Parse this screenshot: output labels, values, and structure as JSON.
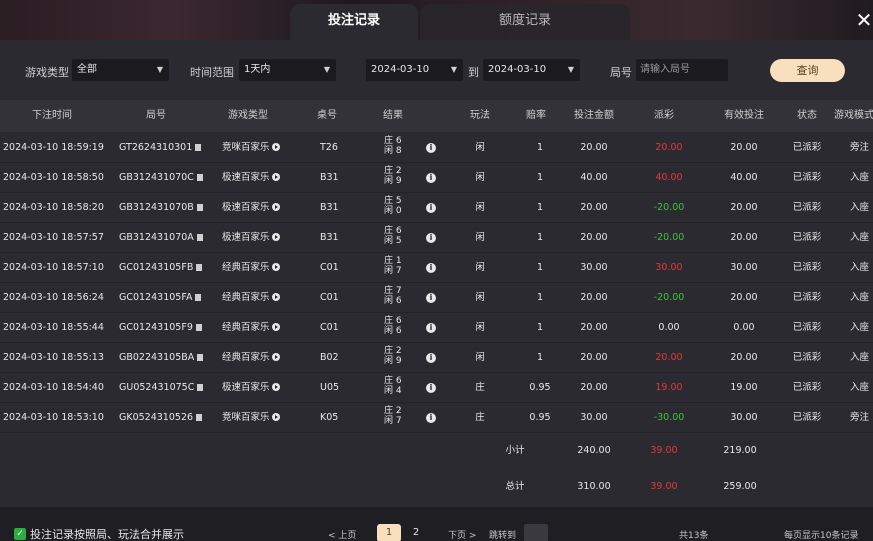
{
  "tabs": [
    {
      "label": "投注记录",
      "active": true
    },
    {
      "label": "额度记录",
      "active": false
    }
  ],
  "close_icon": "close-icon",
  "filters": {
    "game_type_label": "游戏类型",
    "game_type_value": "全部",
    "time_range_label": "时间范围",
    "time_range_value": "1天内",
    "date_from": "2024-03-10",
    "to_label": "到",
    "date_to": "2024-03-10",
    "round_label": "局号",
    "round_placeholder": "请输入局号",
    "query_label": "查询"
  },
  "columns": [
    "下注时间",
    "局号",
    "游戏类型",
    "桌号",
    "结果",
    "玩法",
    "赔率",
    "投注金额",
    "派彩",
    "有效投注",
    "状态",
    "游戏模式"
  ],
  "rows": [
    {
      "time": "2024-03-10 18:59:19",
      "round": "GT2624310301",
      "game": "竞咪百家乐",
      "table": "T26",
      "r1": "庄 6",
      "r2": "闲 8",
      "play": "闲",
      "odds": "1",
      "amount": "20.00",
      "payout": "20.00",
      "payout_sign": "pos",
      "valid": "20.00",
      "status": "已派彩",
      "mode": "旁注"
    },
    {
      "time": "2024-03-10 18:58:50",
      "round": "GB312431070C",
      "game": "极速百家乐",
      "table": "B31",
      "r1": "庄 2",
      "r2": "闲 9",
      "play": "闲",
      "odds": "1",
      "amount": "40.00",
      "payout": "40.00",
      "payout_sign": "pos",
      "valid": "40.00",
      "status": "已派彩",
      "mode": "入座"
    },
    {
      "time": "2024-03-10 18:58:20",
      "round": "GB312431070B",
      "game": "极速百家乐",
      "table": "B31",
      "r1": "庄 5",
      "r2": "闲 0",
      "play": "闲",
      "odds": "1",
      "amount": "20.00",
      "payout": "-20.00",
      "payout_sign": "neg",
      "valid": "20.00",
      "status": "已派彩",
      "mode": "入座"
    },
    {
      "time": "2024-03-10 18:57:57",
      "round": "GB312431070A",
      "game": "极速百家乐",
      "table": "B31",
      "r1": "庄 6",
      "r2": "闲 5",
      "play": "闲",
      "odds": "1",
      "amount": "20.00",
      "payout": "-20.00",
      "payout_sign": "neg",
      "valid": "20.00",
      "status": "已派彩",
      "mode": "入座"
    },
    {
      "time": "2024-03-10 18:57:10",
      "round": "GC01243105FB",
      "game": "经典百家乐",
      "table": "C01",
      "r1": "庄 1",
      "r2": "闲 7",
      "play": "闲",
      "odds": "1",
      "amount": "30.00",
      "payout": "30.00",
      "payout_sign": "pos",
      "valid": "30.00",
      "status": "已派彩",
      "mode": "入座"
    },
    {
      "time": "2024-03-10 18:56:24",
      "round": "GC01243105FA",
      "game": "经典百家乐",
      "table": "C01",
      "r1": "庄 7",
      "r2": "闲 6",
      "play": "闲",
      "odds": "1",
      "amount": "20.00",
      "payout": "-20.00",
      "payout_sign": "neg",
      "valid": "20.00",
      "status": "已派彩",
      "mode": "入座"
    },
    {
      "time": "2024-03-10 18:55:44",
      "round": "GC01243105F9",
      "game": "经典百家乐",
      "table": "C01",
      "r1": "庄 6",
      "r2": "闲 6",
      "play": "闲",
      "odds": "1",
      "amount": "20.00",
      "payout": "0.00",
      "payout_sign": "zero",
      "valid": "0.00",
      "status": "已派彩",
      "mode": "入座"
    },
    {
      "time": "2024-03-10 18:55:13",
      "round": "GB02243105BA",
      "game": "经典百家乐",
      "table": "B02",
      "r1": "庄 2",
      "r2": "闲 9",
      "play": "闲",
      "odds": "1",
      "amount": "20.00",
      "payout": "20.00",
      "payout_sign": "pos",
      "valid": "20.00",
      "status": "已派彩",
      "mode": "入座"
    },
    {
      "time": "2024-03-10 18:54:40",
      "round": "GU052431075C",
      "game": "极速百家乐",
      "table": "U05",
      "r1": "庄 6",
      "r2": "闲 4",
      "play": "庄",
      "odds": "0.95",
      "amount": "20.00",
      "payout": "19.00",
      "payout_sign": "pos",
      "valid": "19.00",
      "status": "已派彩",
      "mode": "入座"
    },
    {
      "time": "2024-03-10 18:53:10",
      "round": "GK0524310526",
      "game": "竞咪百家乐",
      "table": "K05",
      "r1": "庄 2",
      "r2": "闲 7",
      "play": "庄",
      "odds": "0.95",
      "amount": "30.00",
      "payout": "-30.00",
      "payout_sign": "neg",
      "valid": "30.00",
      "status": "已派彩",
      "mode": "旁注"
    }
  ],
  "subtotal": {
    "label": "小计",
    "amount": "240.00",
    "payout": "39.00",
    "valid": "219.00"
  },
  "total": {
    "label": "总计",
    "amount": "310.00",
    "payout": "39.00",
    "valid": "259.00"
  },
  "footer": {
    "merge_label": "投注记录按照局、玩法合并展示",
    "prev_label": "< 上页",
    "page_1": "1",
    "page_2": "2",
    "next_label": "下页 >",
    "jump_label": "跳转到",
    "total_records": "共13条",
    "per_page": "每页显示10条记录"
  },
  "colors": {
    "accent": "#f8dfbe",
    "loss": "#3cc23c",
    "win": "#e03a3a",
    "panel": "#2b2a30"
  }
}
